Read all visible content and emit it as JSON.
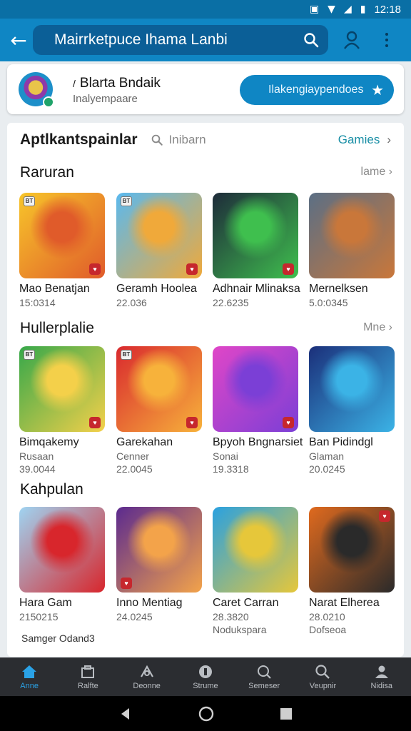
{
  "status_bar": {
    "time": "12:18"
  },
  "app_bar": {
    "title": "Mairrketpuce Ihama Lanbi"
  },
  "profile": {
    "name": "Blarta Bndaik",
    "subtitle": "Inalyempaare",
    "action_label": "Ilakengiaypendoes"
  },
  "top_row": {
    "category_label": "Aptlkantspainlar",
    "search_text": "Inibarn",
    "link_label": "Gamies"
  },
  "sections": [
    {
      "title": "Raruran",
      "more_label": "lame",
      "items": [
        {
          "name": "Mao Benatjan",
          "line1": "15:0314",
          "badge": "BT",
          "colors": [
            "#f7c52a",
            "#e05b2a"
          ]
        },
        {
          "name": "Geramh Hoolea",
          "line1": "22.036",
          "badge": "BT",
          "colors": [
            "#5ab9ef",
            "#f0a93a"
          ]
        },
        {
          "name": "Adhnair Mlinaksa",
          "line1": "22.6235",
          "badge": "",
          "colors": [
            "#1e2b3a",
            "#3fbf4e"
          ]
        },
        {
          "name": "Mernelksen",
          "line1": "5.0:0345",
          "badge": "",
          "colors": [
            "#5b6f85",
            "#c9773a"
          ]
        }
      ]
    },
    {
      "title": "Hullerplalie",
      "more_label": "Mne",
      "items": [
        {
          "name": "Bimqakemy",
          "line1": "Rusaan",
          "line2": "39.0044",
          "badge": "BT",
          "colors": [
            "#36a84a",
            "#f4d04a"
          ]
        },
        {
          "name": "Garekahan",
          "line1": "Cenner",
          "line2": "22.0045",
          "badge": "BT",
          "colors": [
            "#d9292e",
            "#f7b23b"
          ]
        },
        {
          "name": "Bpyoh Bngnarsiet",
          "line1": "Sonai",
          "line2": "19.3318",
          "badge": "",
          "colors": [
            "#e046c7",
            "#7b3fd6"
          ]
        },
        {
          "name": "Ban Pidindgl",
          "line1": "Glaman",
          "line2": "20.0245",
          "badge": "",
          "colors": [
            "#1b2f7a",
            "#3bb3e6"
          ]
        }
      ]
    },
    {
      "title": "Kahpulan",
      "more_label": "",
      "items": [
        {
          "name": "Hara Gam",
          "line1": "2150215",
          "badge": "",
          "colors": [
            "#9fd4f2",
            "#d8262c"
          ]
        },
        {
          "name": "Inno Mentiag",
          "line1": "24.0245",
          "badge": "",
          "colors": [
            "#5b2a8f",
            "#f3a34a"
          ]
        },
        {
          "name": "Caret Carran",
          "line1": "28.3820",
          "badge": "",
          "colors": [
            "#2aa1e0",
            "#e6c73a"
          ]
        },
        {
          "name": "Narat Elherea",
          "line1": "28.0210",
          "badge": "",
          "colors": [
            "#e06a1e",
            "#2a2a2a"
          ]
        }
      ]
    }
  ],
  "row3_extra_line": [
    "",
    "",
    "Nodukspara",
    "Dofseoa"
  ],
  "footer_text": "Samger Odand3",
  "bottom_nav": [
    {
      "label": "Anne",
      "icon": "home-icon",
      "active": true
    },
    {
      "label": "Ralfte",
      "icon": "briefcase-icon",
      "active": false
    },
    {
      "label": "Deonne",
      "icon": "tools-icon",
      "active": false
    },
    {
      "label": "Strume",
      "icon": "badge-icon",
      "active": false
    },
    {
      "label": "Semeser",
      "icon": "chat-icon",
      "active": false
    },
    {
      "label": "Veupnir",
      "icon": "search-icon",
      "active": false
    },
    {
      "label": "Nidisa",
      "icon": "user-icon",
      "active": false
    }
  ],
  "colors": {
    "accent": "#0f86c4",
    "app_bar": "#0f86c4",
    "status_bar": "#0a6fa5",
    "link": "#188ea5",
    "nav_bg": "#2b2d31"
  }
}
